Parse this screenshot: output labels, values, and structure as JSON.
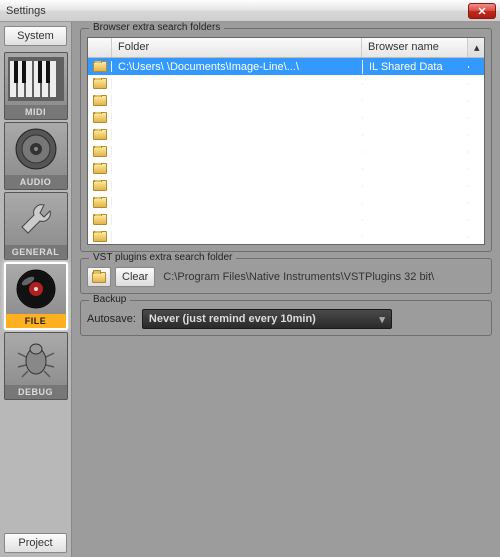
{
  "window": {
    "title": "Settings"
  },
  "sidebar": {
    "system_btn": "System",
    "project_btn": "Project",
    "tabs": [
      {
        "label": "MIDI"
      },
      {
        "label": "AUDIO"
      },
      {
        "label": "GENERAL"
      },
      {
        "label": "FILE"
      },
      {
        "label": "DEBUG"
      }
    ]
  },
  "browser": {
    "legend": "Browser extra search folders",
    "cols": {
      "folder": "Folder",
      "name": "Browser name"
    },
    "rows": [
      {
        "folder": "C:\\Users\\            \\Documents\\Image-Line\\...\\",
        "name": "IL Shared Data"
      },
      {
        "folder": "",
        "name": ""
      },
      {
        "folder": "",
        "name": ""
      },
      {
        "folder": "",
        "name": ""
      },
      {
        "folder": "",
        "name": ""
      },
      {
        "folder": "",
        "name": ""
      },
      {
        "folder": "",
        "name": ""
      },
      {
        "folder": "",
        "name": ""
      },
      {
        "folder": "",
        "name": ""
      },
      {
        "folder": "",
        "name": ""
      },
      {
        "folder": "",
        "name": ""
      }
    ]
  },
  "vst": {
    "legend": "VST plugins extra search folder",
    "clear": "Clear",
    "path": "C:\\Program Files\\Native Instruments\\VSTPlugins 32 bit\\"
  },
  "backup": {
    "legend": "Backup",
    "label": "Autosave:",
    "value": "Never (just remind every 10min)"
  }
}
